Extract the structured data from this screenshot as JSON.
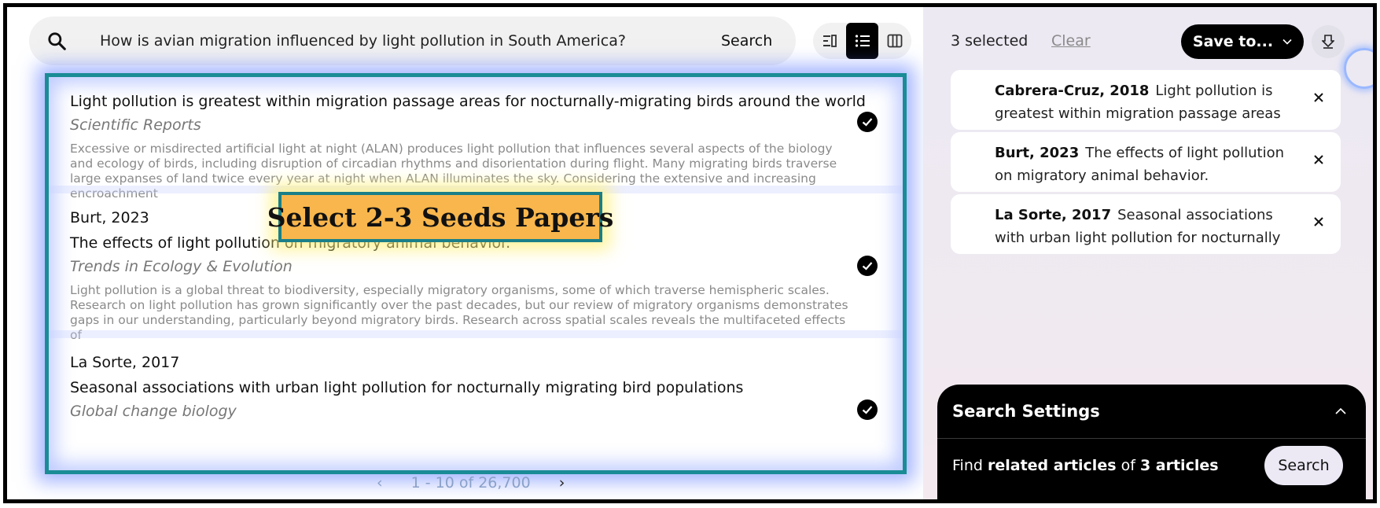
{
  "search": {
    "query": "How is avian migration influenced by light pollution in South America?",
    "button_label": "Search"
  },
  "view_modes": [
    "list-compact",
    "list",
    "columns"
  ],
  "results": [
    {
      "title": "Light pollution is greatest within migration passage areas for nocturnally-migrating birds around the world",
      "journal": "Scientific Reports",
      "abstract": "Excessive or misdirected artificial light at night (ALAN) produces light pollution that influences several aspects of the biology and ecology of birds, including disruption of circadian rhythms and disorientation during flight. Many migrating birds traverse large expanses of land twice every year at night when ALAN illuminates the sky. Considering the extensive and increasing encroachment",
      "selected": true
    },
    {
      "author": "Burt, 2023",
      "title": "The effects of light pollution on migratory animal behavior.",
      "journal": "Trends in Ecology & Evolution",
      "abstract": "Light pollution is a global threat to biodiversity, especially migratory organisms, some of which traverse hemispheric scales. Research on light pollution has grown significantly over the past decades, but our review of migratory organisms demonstrates gaps in our understanding, particularly beyond migratory birds. Research across spatial scales reveals the multifaceted effects of",
      "selected": true
    },
    {
      "author": "La Sorte, 2017",
      "title": "Seasonal associations with urban light pollution for nocturnally migrating bird populations",
      "journal": "Global change biology",
      "selected": true
    }
  ],
  "callout": "Select 2-3 Seeds Papers",
  "pagination": {
    "label": "1 - 10 of 26,700"
  },
  "selection": {
    "count_label": "3 selected",
    "clear_label": "Clear",
    "save_label": "Save to...",
    "items": [
      {
        "author": "Cabrera-Cruz, 2018",
        "title": "Light pollution is greatest within migration passage areas"
      },
      {
        "author": "Burt, 2023",
        "title": "The effects of light pollution on migratory animal behavior."
      },
      {
        "author": "La Sorte, 2017",
        "title": "Seasonal associations with urban light pollution for nocturnally"
      }
    ]
  },
  "settings": {
    "heading": "Search Settings",
    "find_prefix": "Find",
    "find_bold1": "related articles",
    "find_mid": "of",
    "find_bold2": "3 articles",
    "button_label": "Search"
  },
  "colors": {
    "highlight_border": "#1a8c96",
    "callout_bg": "#f8b64c",
    "glow": "#5a78ff"
  }
}
